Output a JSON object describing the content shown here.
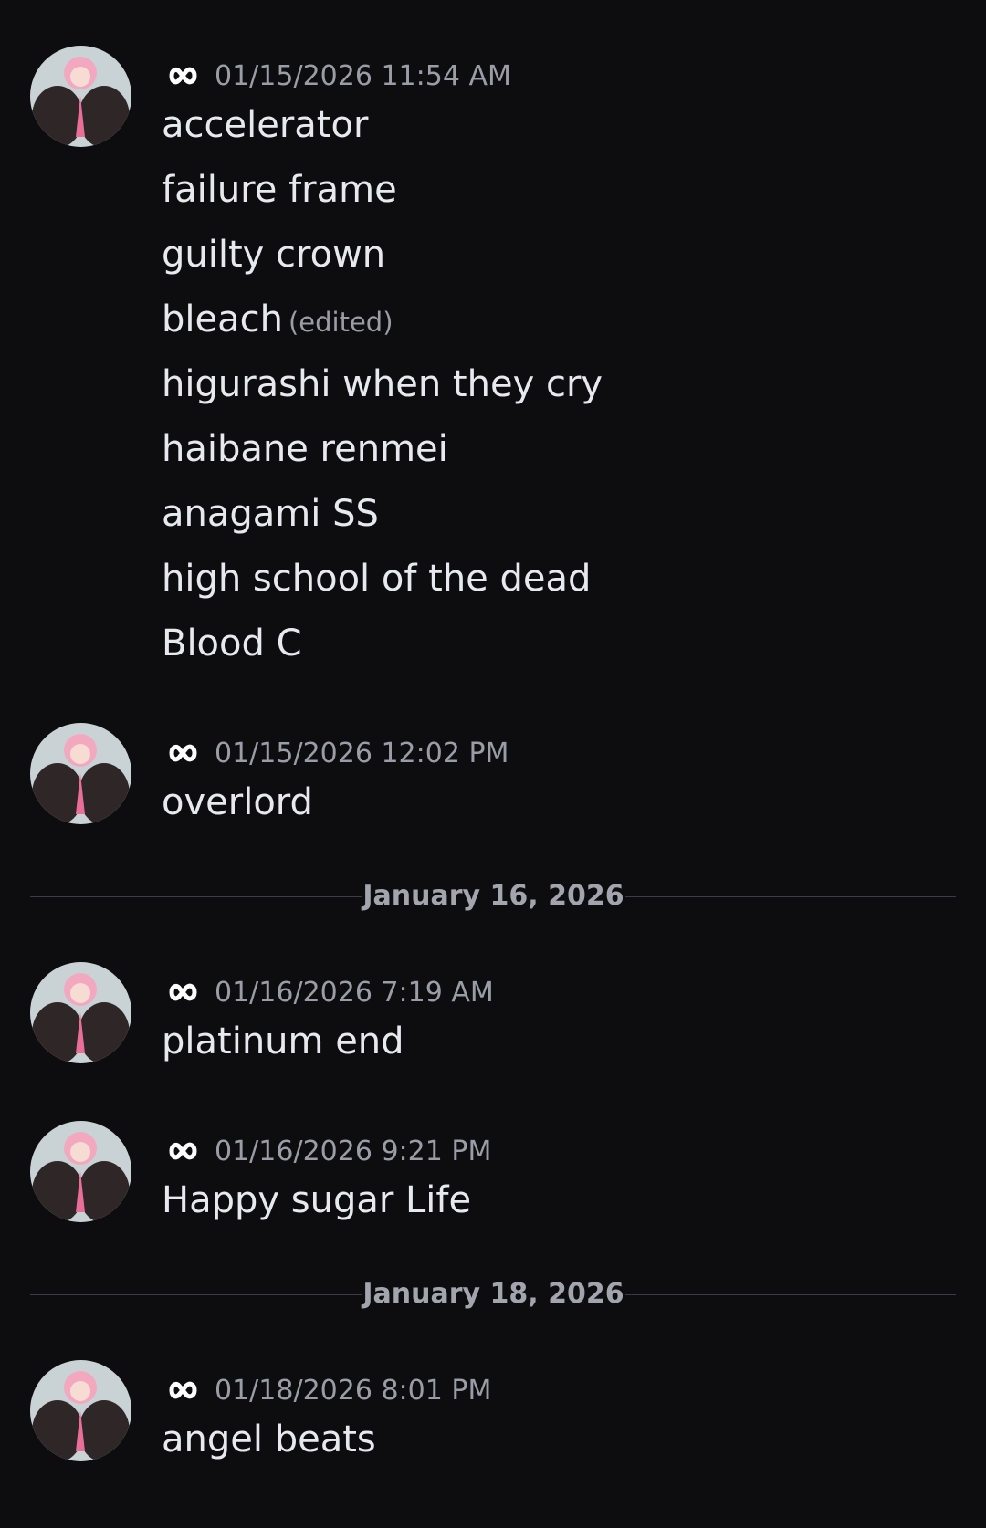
{
  "messages": [
    {
      "timestamp": "01/15/2026 11:54 AM",
      "lines": [
        "accelerator",
        "failure frame",
        "guilty crown",
        "bleach",
        "higurashi when they cry",
        "haibane renmei",
        "anagami SS",
        "high school of the dead",
        "Blood C"
      ],
      "edited_label": "(edited)"
    },
    {
      "timestamp": "01/15/2026 12:02 PM",
      "lines": [
        "overlord"
      ]
    },
    {
      "timestamp": "01/16/2026 7:19 AM",
      "lines": [
        "platinum end"
      ]
    },
    {
      "timestamp": "01/16/2026 9:21 PM",
      "lines": [
        "Happy sugar Life"
      ]
    },
    {
      "timestamp": "01/18/2026 8:01 PM",
      "lines": [
        "angel beats"
      ]
    }
  ],
  "dividers": [
    "January 16, 2026",
    "January 18, 2026"
  ],
  "icons": {
    "username": "infinity-icon",
    "avatar": "anime-avatar"
  },
  "colors": {
    "background": "#0d0d0f",
    "text": "#e8e9ee",
    "muted": "#9a9ca6",
    "divider": "#3c3d44"
  }
}
